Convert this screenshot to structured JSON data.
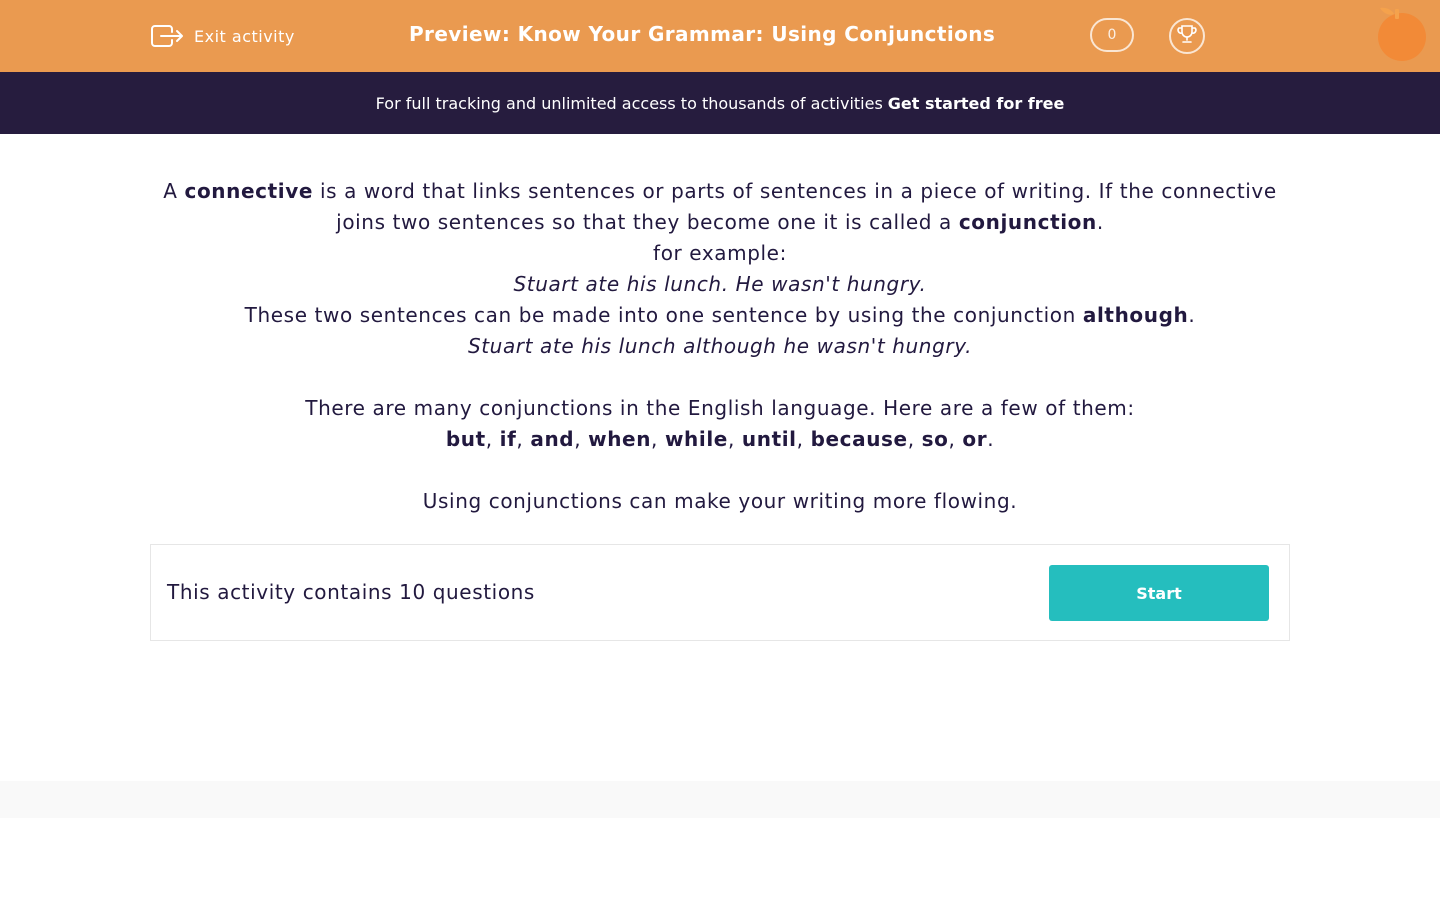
{
  "header": {
    "exit_label": "Exit activity",
    "title": "Preview: Know Your Grammar: Using Conjunctions",
    "score": "0",
    "colors": {
      "bar": "#ea9a50",
      "logo": "#f28a37"
    }
  },
  "promo": {
    "text": "For full tracking and unlimited access to thousands of activities",
    "link": "Get started for free"
  },
  "intro": {
    "p1": {
      "a": "A",
      "connective": "connective",
      "b": "is a word that links sentences or parts of sentences in a piece of writing. If the connective joins two sentences so that they become one it is called a",
      "conjunction": "conjunction",
      "c": "."
    },
    "for_example": "for example:",
    "example1": "Stuart ate his lunch. He wasn't hungry.",
    "p2": {
      "a": "These two sentences can be made into one sentence by using the conjunction",
      "although": "although",
      "b": "."
    },
    "example2": "Stuart ate his lunch although he wasn't hungry.",
    "p3": "There are many conjunctions in the English language. Here are a few of them:",
    "conjunctions": [
      "but",
      "if",
      "and",
      "when",
      "while",
      "until",
      "because",
      "so",
      "or"
    ],
    "conj_separator": ", ",
    "conj_end": ".",
    "p4": "Using conjunctions can make your writing more flowing."
  },
  "activity": {
    "text": "This activity contains 10 questions",
    "start_label": "Start",
    "start_color": "#25bebe"
  }
}
